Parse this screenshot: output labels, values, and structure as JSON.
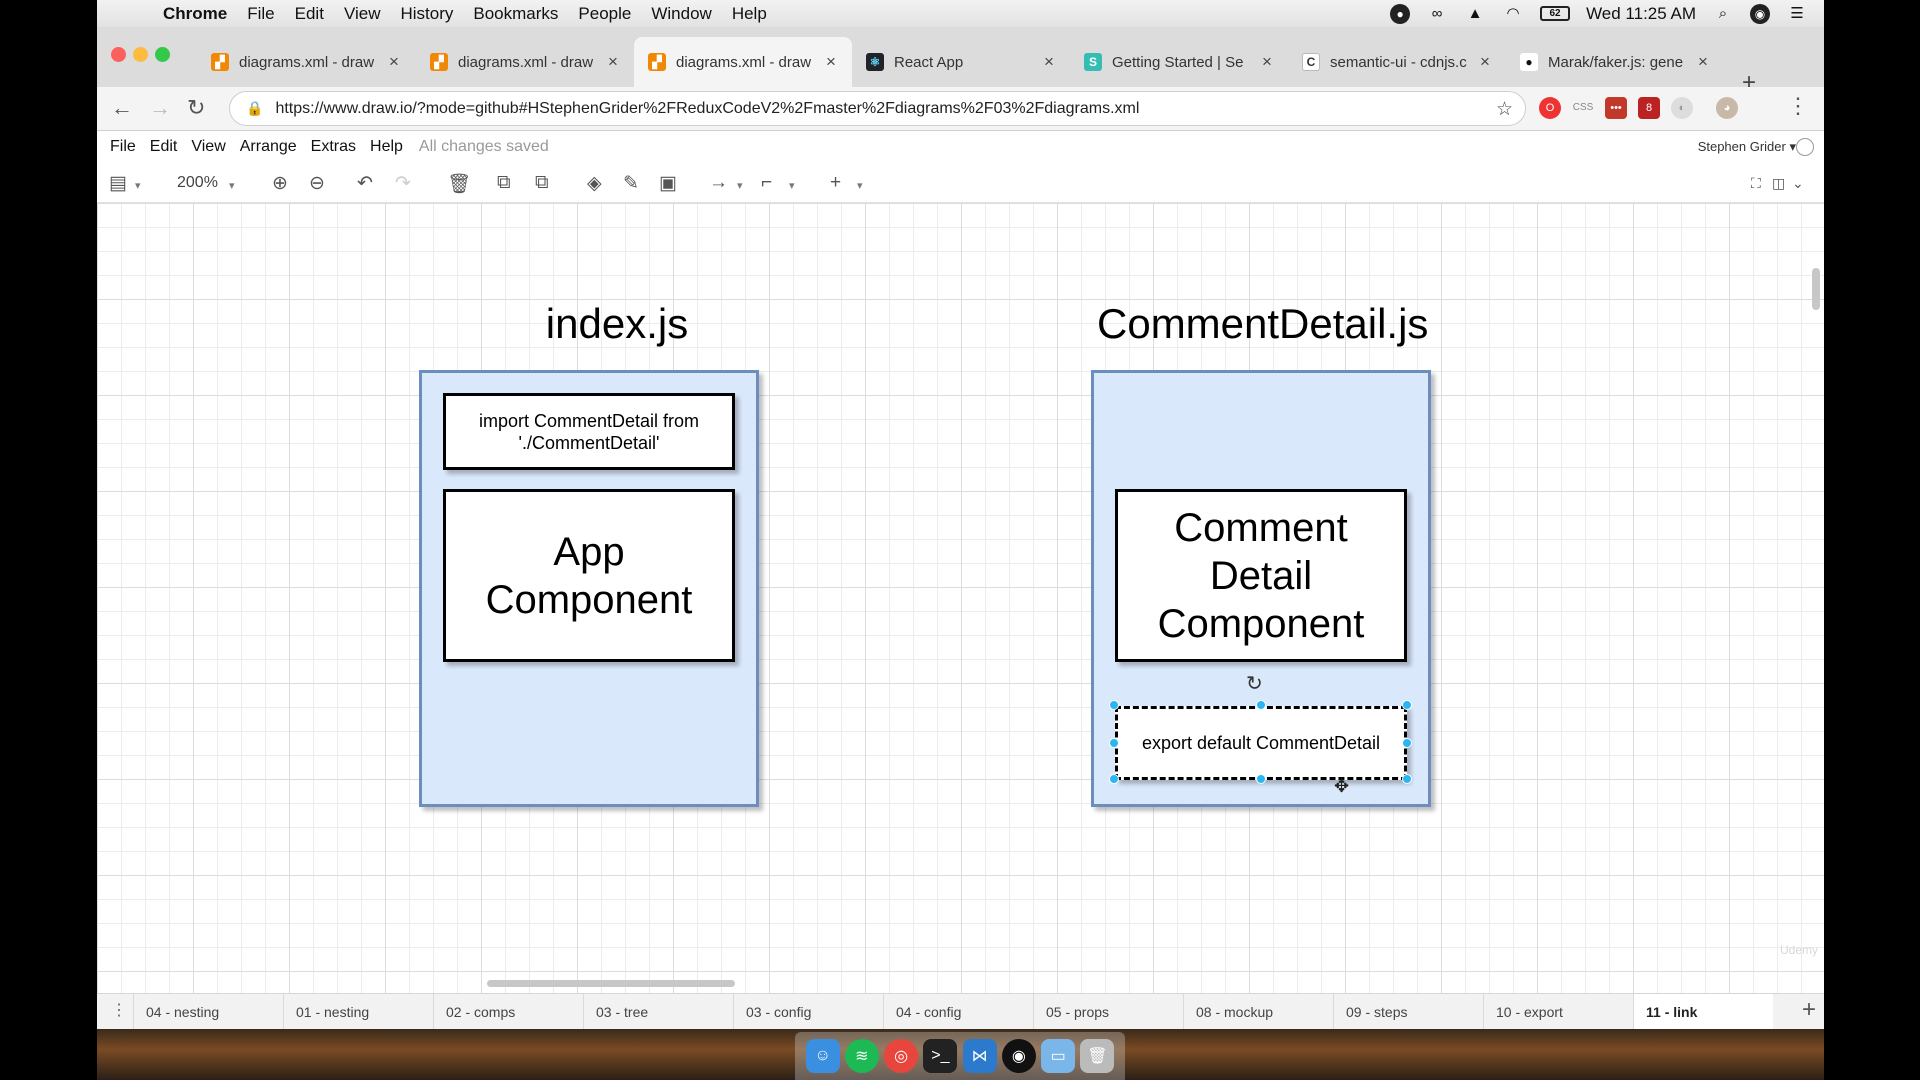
{
  "mac_menubar": {
    "items": [
      "Chrome",
      "File",
      "Edit",
      "View",
      "History",
      "Bookmarks",
      "People",
      "Window",
      "Help"
    ],
    "clock": "Wed 11:25 AM",
    "battery": "62"
  },
  "browser": {
    "tabs": [
      {
        "title": "diagrams.xml - draw",
        "icon": "drawio-icon"
      },
      {
        "title": "diagrams.xml - draw",
        "icon": "drawio-icon"
      },
      {
        "title": "diagrams.xml - draw",
        "icon": "drawio-icon",
        "active": true
      },
      {
        "title": "React App",
        "icon": "react-icon"
      },
      {
        "title": "Getting Started | Se",
        "icon": "semantic-ui-icon"
      },
      {
        "title": "semantic-ui - cdnjs.c",
        "icon": "cdnjs-icon"
      },
      {
        "title": "Marak/faker.js: gene",
        "icon": "github-icon"
      }
    ],
    "url": "https://www.draw.io/?mode=github#HStephenGrider%2FReduxCodeV2%2Fmaster%2Fdiagrams%2F03%2Fdiagrams.xml",
    "ext_css": "CSS",
    "ext_badge": "8"
  },
  "app": {
    "menu": [
      "File",
      "Edit",
      "View",
      "Arrange",
      "Extras",
      "Help"
    ],
    "status": "All changes saved",
    "user": "Stephen Grider",
    "zoom": "200%"
  },
  "diagram": {
    "left_title": "index.js",
    "left_import": "import CommentDetail from './CommentDetail'",
    "left_component": "App Component",
    "right_title": "CommentDetail.js",
    "right_component": "Comment Detail Component",
    "right_export": "export default CommentDetail"
  },
  "pages": [
    "04 - nesting",
    "01 - nesting",
    "02 - comps",
    "03 - tree",
    "03 - config",
    "04 - config",
    "05 - props",
    "08 - mockup",
    "09 - steps",
    "10 - export",
    "11 - link"
  ],
  "active_page": "11 - link",
  "watermark": "Udemy",
  "colors": {
    "container_fill": "#dae8fc",
    "container_stroke": "#6c8ebf",
    "selection_handle": "#29b6f2"
  }
}
